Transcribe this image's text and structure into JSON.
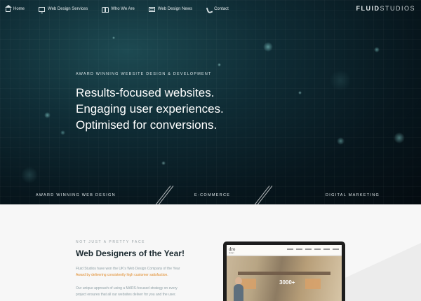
{
  "nav": {
    "items": [
      {
        "label": "Home",
        "icon": "home-icon"
      },
      {
        "label": "Web Design Services",
        "icon": "monitor-icon"
      },
      {
        "label": "Who We Are",
        "icon": "people-icon"
      },
      {
        "label": "Web Design News",
        "icon": "newspaper-icon"
      },
      {
        "label": "Contact",
        "icon": "phone-icon"
      }
    ],
    "logo_bold": "FLUID",
    "logo_thin": "STUDIOS"
  },
  "hero": {
    "eyebrow": "AWARD WINNING WEBSITE DESIGN & DEVELOPMENT",
    "lines": [
      "Results-focused websites.",
      "Engaging user experiences.",
      "Optimised for conversions."
    ]
  },
  "bands": [
    "AWARD WINNING WEB DESIGN",
    "E-COMMERCE",
    "DIGITAL MARKETING"
  ],
  "intro": {
    "eyebrow": "NOT JUST A PRETTY FACE",
    "title": "Web Designers of the Year!",
    "para1_a": "Fluid Studios have won the UK's Web Design Company of the Year",
    "para1_b": "Award by delivering consistently high customer satisfaction.",
    "para2_a": "Our unique approach of using a MARS-focused strategy on every",
    "para2_b": "project ensures that all our websites deliver for you and the user."
  },
  "laptop_screen": {
    "logo": "dro",
    "sub": "design",
    "stat": "3000+"
  },
  "colors": {
    "hero_dark": "#07161d",
    "hero_teal": "#1d4a52",
    "accent_orange": "#e08b2a",
    "lower_bg": "#f7f7f7",
    "title_dark": "#1b2a30"
  }
}
